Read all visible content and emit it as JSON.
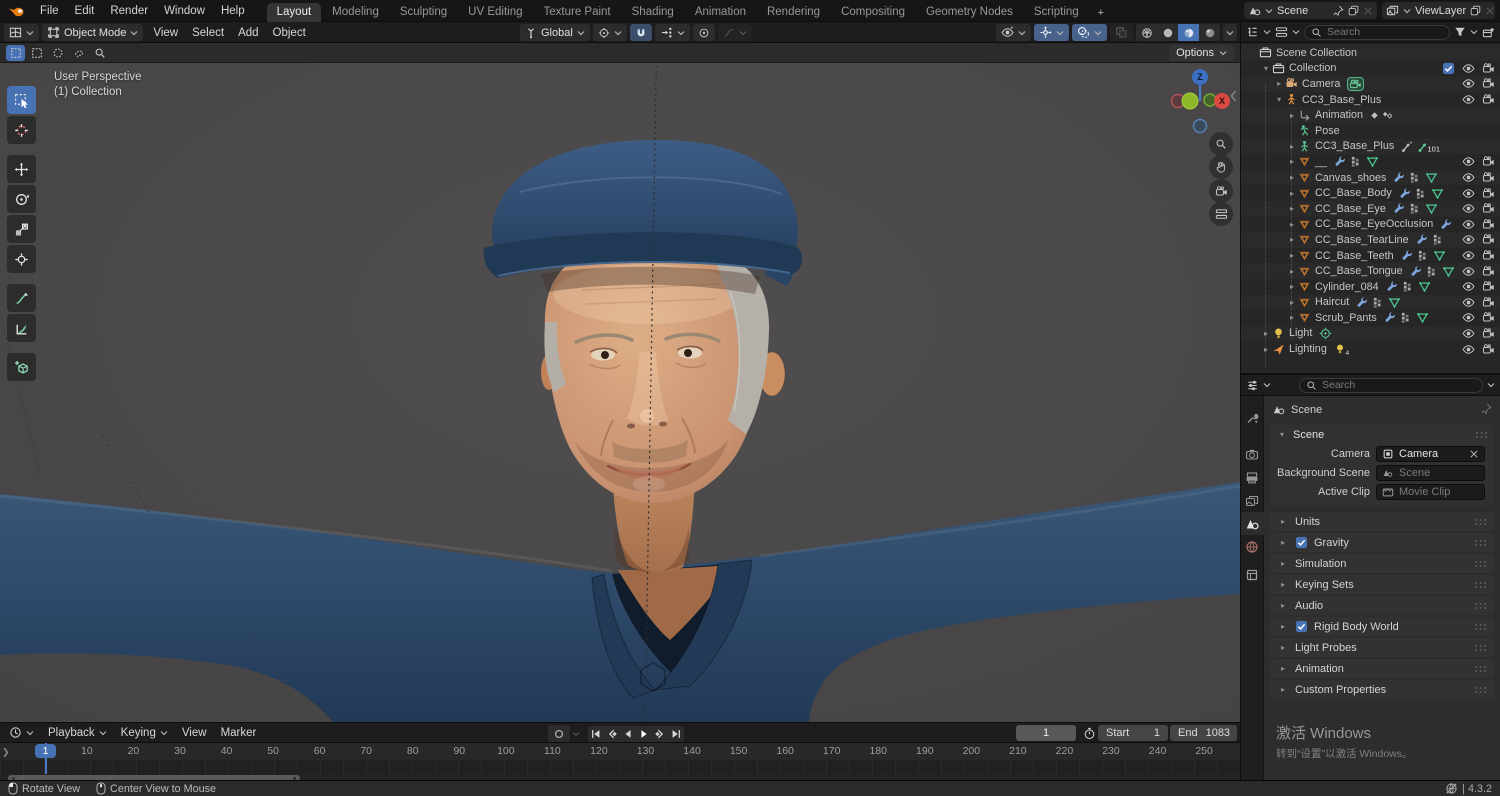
{
  "topbar": {
    "menus": [
      "File",
      "Edit",
      "Render",
      "Window",
      "Help"
    ],
    "tabs": [
      {
        "label": "Layout",
        "active": true
      },
      {
        "label": "Modeling"
      },
      {
        "label": "Sculpting"
      },
      {
        "label": "UV Editing"
      },
      {
        "label": "Texture Paint"
      },
      {
        "label": "Shading"
      },
      {
        "label": "Animation"
      },
      {
        "label": "Rendering"
      },
      {
        "label": "Compositing"
      },
      {
        "label": "Geometry Nodes"
      },
      {
        "label": "Scripting"
      }
    ],
    "add_tab": "+",
    "scene": {
      "label": "Scene"
    },
    "view_layer": {
      "label": "ViewLayer"
    }
  },
  "viewport": {
    "mode": "Object Mode",
    "menus": [
      "View",
      "Select",
      "Add",
      "Object"
    ],
    "orientation": "Global",
    "options_label": "Options",
    "overlay": {
      "line1": "User Perspective",
      "line2": "(1) Collection"
    },
    "gizmo": {
      "z": "Z",
      "x": "X"
    },
    "tools": [
      "select-box",
      "cursor",
      "move",
      "rotate",
      "scale",
      "transform",
      "annotate",
      "measure",
      "add-cube"
    ],
    "select_modes": [
      "tweak",
      "select-box",
      "select-circle",
      "select-lasso",
      "select-paint"
    ],
    "header_toggles": [
      "visibility",
      "gizmos",
      "overlays",
      "xray"
    ],
    "shading_modes": [
      "wireframe",
      "solid",
      "material-preview",
      "rendered"
    ],
    "active_shading_index": 2,
    "nav_buttons": [
      "zoom",
      "pan",
      "camera-view",
      "toggle-projection"
    ]
  },
  "outliner": {
    "search_placeholder": "Search",
    "rows": [
      {
        "label": "Scene Collection",
        "icon": "collection",
        "indent": 0,
        "caret": "",
        "badges": [],
        "right": []
      },
      {
        "label": "Collection",
        "icon": "collection",
        "indent": 1,
        "caret": "open",
        "badges": [],
        "right": [
          "check",
          "eye",
          "cam"
        ]
      },
      {
        "label": "Camera",
        "icon": "camobj",
        "indent": 2,
        "caret": "closed",
        "badges": [
          "camdata"
        ],
        "right": [
          "eye",
          "cam"
        ]
      },
      {
        "label": "CC3_Base_Plus",
        "icon": "armature",
        "indent": 2,
        "caret": "open",
        "badges": [],
        "right": [
          "eye",
          "cam"
        ]
      },
      {
        "label": "Animation",
        "icon": "action",
        "indent": 3,
        "caret": "closed",
        "badges": [
          "keyf",
          "keyf2"
        ],
        "right": []
      },
      {
        "label": "Pose",
        "icon": "pose",
        "indent": 3,
        "caret": "none",
        "badges": [],
        "right": []
      },
      {
        "label": "CC3_Base_Plus",
        "icon": "armgreen",
        "indent": 3,
        "caret": "closed",
        "badges": [
          "bones",
          "bone101"
        ],
        "right": []
      },
      {
        "label": "__",
        "icon": "meshorange",
        "indent": 3,
        "caret": "closed",
        "badges": [
          "wrench",
          "vgroup",
          "meshdata"
        ],
        "right": [
          "eye",
          "cam"
        ]
      },
      {
        "label": "Canvas_shoes",
        "icon": "meshorange",
        "indent": 3,
        "caret": "closed",
        "badges": [
          "wrench",
          "vgroup",
          "meshdata"
        ],
        "right": [
          "eye",
          "cam"
        ]
      },
      {
        "label": "CC_Base_Body",
        "icon": "meshorange",
        "indent": 3,
        "caret": "closed",
        "badges": [
          "wrench",
          "vgroup",
          "meshdata"
        ],
        "right": [
          "eye",
          "cam"
        ]
      },
      {
        "label": "CC_Base_Eye",
        "icon": "meshorange",
        "indent": 3,
        "caret": "closed",
        "badges": [
          "wrench",
          "vgroup",
          "meshdata"
        ],
        "right": [
          "eye",
          "cam"
        ]
      },
      {
        "label": "CC_Base_EyeOcclusion",
        "icon": "meshorange",
        "indent": 3,
        "caret": "closed",
        "badges": [
          "wrench"
        ],
        "right": [
          "eye",
          "cam"
        ]
      },
      {
        "label": "CC_Base_TearLine",
        "icon": "meshorange",
        "indent": 3,
        "caret": "closed",
        "badges": [
          "wrench",
          "vgroup"
        ],
        "right": [
          "eye",
          "cam"
        ]
      },
      {
        "label": "CC_Base_Teeth",
        "icon": "meshorange",
        "indent": 3,
        "caret": "closed",
        "badges": [
          "wrench",
          "vgroup",
          "meshdata"
        ],
        "right": [
          "eye",
          "cam"
        ]
      },
      {
        "label": "CC_Base_Tongue",
        "icon": "meshorange",
        "indent": 3,
        "caret": "closed",
        "badges": [
          "wrench",
          "vgroup",
          "meshdata"
        ],
        "right": [
          "eye",
          "cam"
        ]
      },
      {
        "label": "Cylinder_084",
        "icon": "meshorange",
        "indent": 3,
        "caret": "closed",
        "badges": [
          "wrench",
          "vgroup",
          "meshdata"
        ],
        "right": [
          "eye",
          "cam"
        ]
      },
      {
        "label": "Haircut",
        "icon": "meshorange",
        "indent": 3,
        "caret": "closed",
        "badges": [
          "wrench",
          "vgroup",
          "meshdata"
        ],
        "right": [
          "eye",
          "cam"
        ]
      },
      {
        "label": "Scrub_Pants",
        "icon": "meshorange",
        "indent": 3,
        "caret": "closed",
        "badges": [
          "wrench",
          "vgroup",
          "meshdata"
        ],
        "right": [
          "eye",
          "cam"
        ]
      },
      {
        "label": "Light",
        "icon": "light",
        "indent": 1,
        "caret": "closed",
        "badges": [
          "pointlight"
        ],
        "right": [
          "eye",
          "cam"
        ]
      },
      {
        "label": "Lighting",
        "icon": "emptyicon",
        "indent": 1,
        "caret": "closed",
        "badges": [
          "light4"
        ],
        "right": [
          "eye",
          "cam"
        ]
      }
    ]
  },
  "properties": {
    "search_placeholder": "Search",
    "tabs": [
      "tool",
      "render",
      "output",
      "view-layer",
      "scene",
      "world",
      "object"
    ],
    "active_tab": "scene",
    "breadcrumb": "Scene",
    "scene_panel": {
      "title": "Scene",
      "fields": [
        {
          "label": "Camera",
          "value": "Camera",
          "icon": "cammini",
          "ghost": false,
          "clear": true
        },
        {
          "label": "Background Scene",
          "value": "Scene",
          "icon": "scenemini",
          "ghost": true,
          "clear": false
        },
        {
          "label": "Active Clip",
          "value": "Movie Clip",
          "icon": "clip",
          "ghost": true,
          "clear": false
        }
      ]
    },
    "panels": [
      {
        "label": "Units"
      },
      {
        "label": "Gravity",
        "checked": true
      },
      {
        "label": "Simulation"
      },
      {
        "label": "Keying Sets"
      },
      {
        "label": "Audio"
      },
      {
        "label": "Rigid Body World",
        "checked": true
      },
      {
        "label": "Light Probes"
      },
      {
        "label": "Animation"
      },
      {
        "label": "Custom Properties"
      }
    ]
  },
  "timeline": {
    "menus": [
      {
        "label": "Playback",
        "caret": true
      },
      {
        "label": "Keying",
        "caret": true
      },
      {
        "label": "View",
        "caret": false
      },
      {
        "label": "Marker",
        "caret": false
      }
    ],
    "playback_buttons": [
      "jump-to-start",
      "prev-keyframe",
      "play-reverse",
      "play",
      "next-keyframe",
      "jump-to-end"
    ],
    "current_frame": "1",
    "start_label": "Start",
    "start_value": "1",
    "end_label": "End",
    "end_value": "1083",
    "playhead": "1",
    "ruler": [
      10,
      20,
      30,
      40,
      50,
      60,
      70,
      80,
      90,
      100,
      110,
      120,
      130,
      140,
      150,
      160,
      170,
      180,
      190,
      200,
      210,
      220,
      230,
      240,
      250
    ]
  },
  "statusbar": {
    "left": [
      {
        "icon": "mouse-left",
        "label": "Rotate View"
      },
      {
        "icon": "mouse-middle",
        "label": "Center View to Mouse"
      }
    ],
    "version_text": "| 4.3.2"
  },
  "watermark": {
    "line1": "激活 Windows",
    "line2": "转到“设置”以激活 Windows。"
  },
  "colors": {
    "accent": "#4772b3",
    "mesh_orange": "#e8913f",
    "data_green": "#49c98f",
    "modifier_blue": "#7da7dd",
    "cap_navy": "#2c4868",
    "skin": "#d2a078"
  }
}
